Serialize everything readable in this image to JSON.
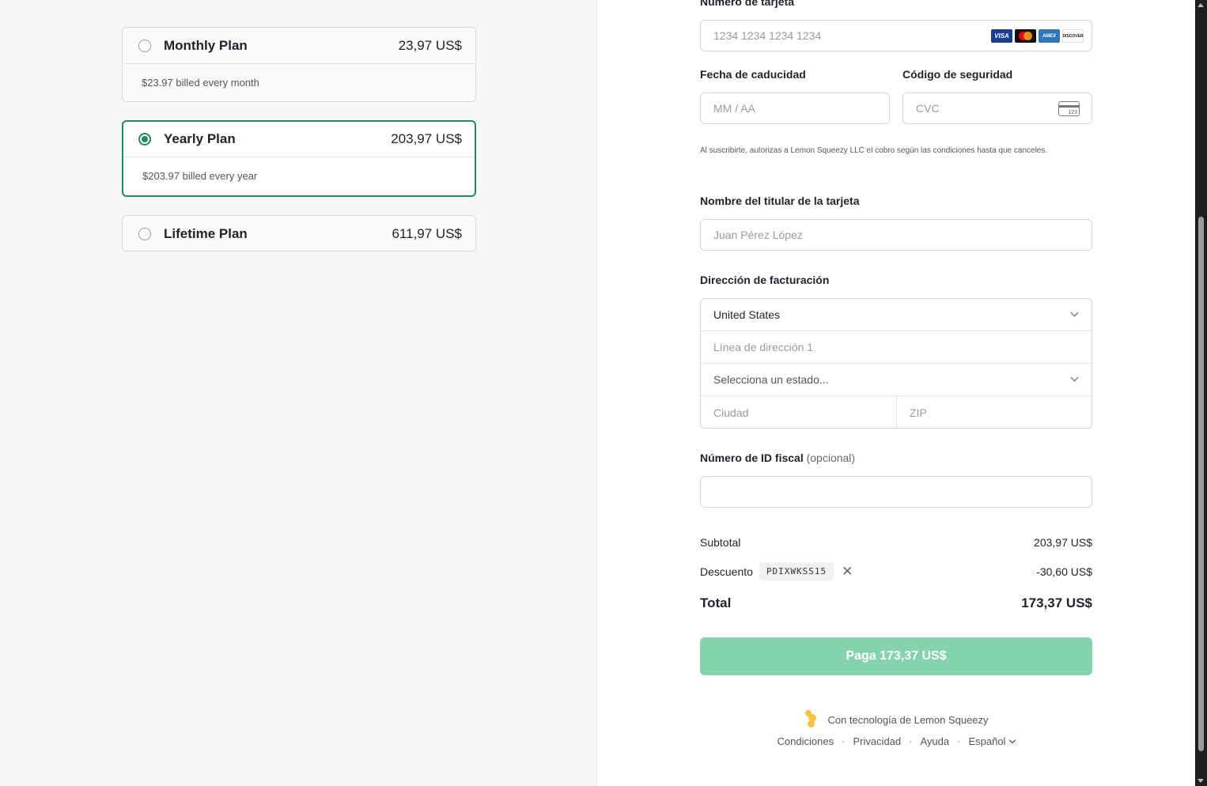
{
  "plans": [
    {
      "name": "Monthly Plan",
      "price": "23,97 US$",
      "note": "$23.97 billed every month",
      "selected": false
    },
    {
      "name": "Yearly Plan",
      "price": "203,97 US$",
      "note": "$203.97 billed every year",
      "selected": true
    },
    {
      "name": "Lifetime Plan",
      "price": "611,97 US$",
      "selected": false
    }
  ],
  "payment": {
    "card_label": "Número de tarjeta",
    "card_placeholder": "1234 1234 1234 1234",
    "brands": [
      "VISA",
      "mastercard",
      "AMEX",
      "DISCOVER"
    ],
    "expiry_label": "Fecha de caducidad",
    "expiry_placeholder": "MM / AA",
    "cvc_label": "Código de seguridad",
    "cvc_placeholder": "CVC",
    "cvc_icon_text": "123",
    "consent": "Al suscribirte, autorizas a Lemon Squeezy LLC el cobro según las condiciones hasta que canceles."
  },
  "holder": {
    "label": "Nombre del titular de la tarjeta",
    "placeholder": "Juan Pérez López"
  },
  "billing": {
    "label": "Dirección de facturación",
    "country": "United States",
    "line1_placeholder": "Línea de dirección 1",
    "state_placeholder": "Selecciona un estado...",
    "city_placeholder": "Ciudad",
    "zip_placeholder": "ZIP"
  },
  "tax": {
    "label": "Número de ID fiscal",
    "optional": "(opcional)",
    "value": ""
  },
  "summary": {
    "subtotal_label": "Subtotal",
    "subtotal_value": "203,97 US$",
    "discount_label": "Descuento",
    "discount_code": "PDIXWKSS15",
    "discount_value": "-30,60 US$",
    "total_label": "Total",
    "total_value": "173,37 US$"
  },
  "pay_button": "Paga 173,37 US$",
  "footer": {
    "powered": "Con tecnología de Lemon Squeezy",
    "links": [
      "Condiciones",
      "Privacidad",
      "Ayuda"
    ],
    "language": "Español",
    "separator": "·"
  },
  "colors": {
    "accent": "#1f8a5b",
    "pay_button": "#85d3ad",
    "lemon": "#f6c343"
  }
}
